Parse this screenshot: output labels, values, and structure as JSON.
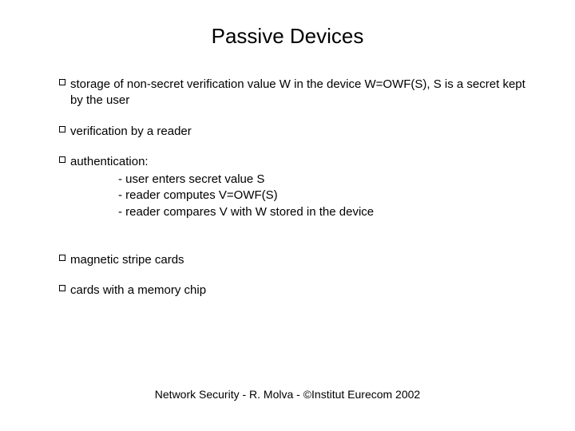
{
  "title": "Passive Devices",
  "bullets": {
    "b0": "storage of non-secret verification value W in the device W=OWF(S), S is a secret kept by the user",
    "b1": "verification by a reader",
    "b2": "authentication:",
    "b2_subs": {
      "s0": "- user enters secret value S",
      "s1": "- reader computes V=OWF(S)",
      "s2": "- reader compares V with W stored in the device"
    },
    "b3": "magnetic stripe cards",
    "b4": "cards with a memory chip"
  },
  "footer": "Network Security - R. Molva - ©Institut Eurecom 2002"
}
